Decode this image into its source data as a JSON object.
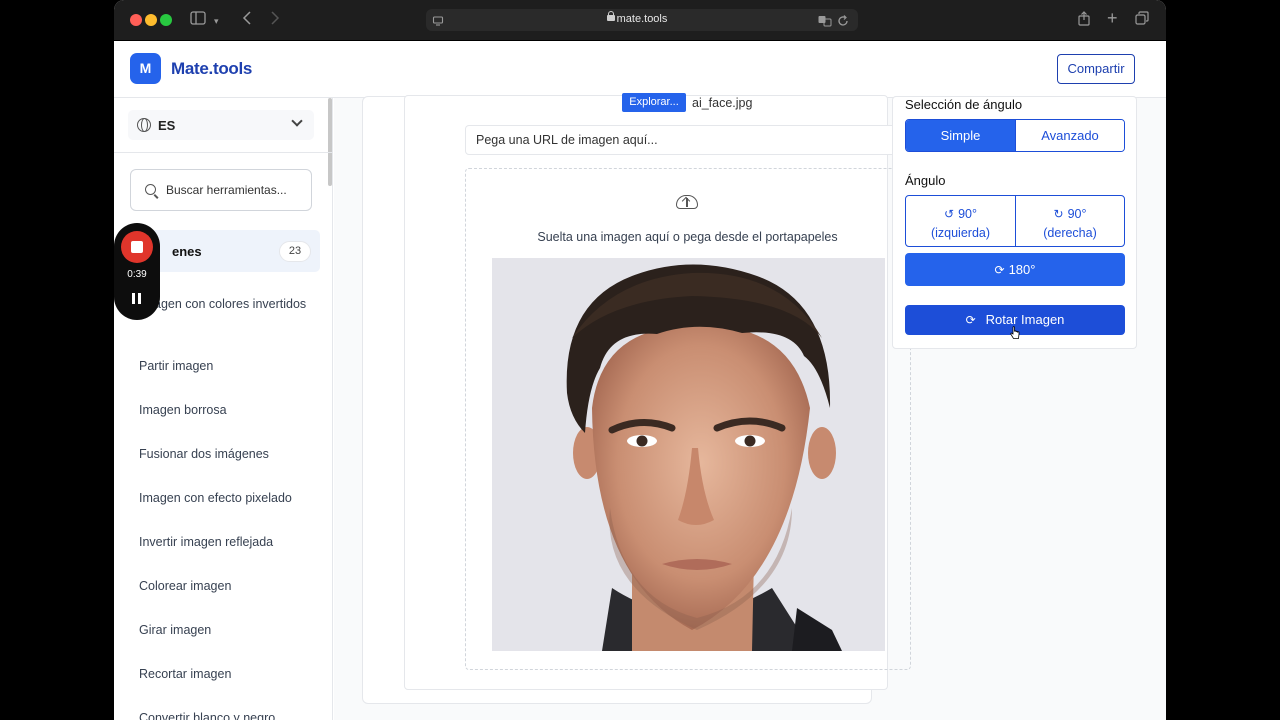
{
  "browser": {
    "url": "mate.tools"
  },
  "header": {
    "logo_badge": "M",
    "logo_text": "Mate.tools",
    "share_label": "Compartir"
  },
  "sidebar": {
    "language": "ES",
    "search_placeholder": "Buscar herramientas...",
    "category": {
      "label": "enes",
      "count": "23"
    },
    "items": [
      {
        "label": "agen con colores invertidos"
      },
      {
        "label": "Partir imagen"
      },
      {
        "label": "Imagen borrosa"
      },
      {
        "label": "Fusionar dos imágenes"
      },
      {
        "label": "Imagen con efecto pixelado"
      },
      {
        "label": "Invertir imagen reflejada"
      },
      {
        "label": "Colorear imagen"
      },
      {
        "label": "Girar imagen"
      },
      {
        "label": "Recortar imagen"
      },
      {
        "label": "Convertir blanco y negro"
      }
    ]
  },
  "recorder": {
    "time": "0:39"
  },
  "upload": {
    "browse_label": "Explorar...",
    "filename": "ai_face.jpg",
    "url_placeholder": "Pega una URL de imagen aquí...",
    "dropzone_text": "Suelta una imagen aquí o pega desde el portapapeles"
  },
  "panel": {
    "angle_selection_label": "Selección de ángulo",
    "mode_simple": "Simple",
    "mode_advanced": "Avanzado",
    "angle_label": "Ángulo",
    "angle_left_value": "90°",
    "angle_left_dir": "(izquierda)",
    "angle_right_value": "90°",
    "angle_right_dir": "(derecha)",
    "angle_180": "180°",
    "rotate_button": "Rotar Imagen"
  },
  "colors": {
    "accent": "#2563eb",
    "accent_dark": "#1d4ed8",
    "brand_text": "#1e40af",
    "record": "#e0352b"
  }
}
